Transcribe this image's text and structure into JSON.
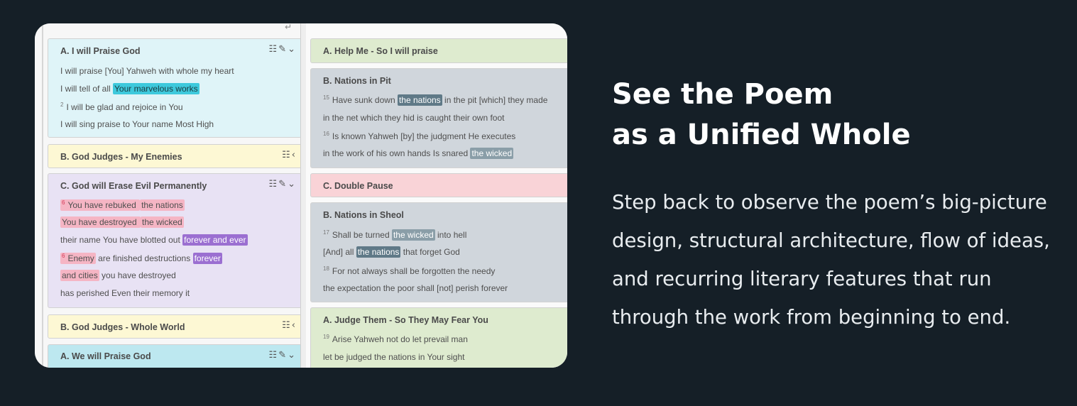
{
  "left_blocks": [
    {
      "title": "A. I will Praise God",
      "icons": "☷✎⌄",
      "lines": [
        {
          "pre": "I will praise [You] Yahweh with whole my heart"
        },
        {
          "pre": "I will tell of all ",
          "hl": "Your marvelous works"
        },
        {
          "mark": "2",
          "pre": "I will be glad  and rejoice in You"
        },
        {
          "pre": "I will sing praise to Your name Most High"
        }
      ]
    },
    {
      "title": "B. God Judges - My Enemies",
      "icons": "☷‹"
    },
    {
      "title": "C. God will Erase Evil Permanently",
      "icons": "☷✎⌄",
      "lines": [
        {
          "mark": "6",
          "pre": "You have rebuked ",
          "hl": "the nations"
        },
        {
          "pre": "You have destroyed ",
          "hl": "the wicked"
        },
        {
          "pre": "their name You have blotted out ",
          "hl": "forever and ever"
        },
        {
          "mark": "6",
          "pre": "Enemy",
          "mid": " are finished destructions ",
          "hl": "forever"
        },
        {
          "pre": "and cities",
          "mid": " you have destroyed"
        },
        {
          "pre": "has perished Even their memory it"
        }
      ]
    },
    {
      "title": "B. God Judges - Whole World",
      "icons": "☷‹"
    },
    {
      "title": "A. We will Praise God",
      "icons": "☷✎⌄"
    }
  ],
  "right_blocks": [
    {
      "title": "A. Help Me - So I will praise"
    },
    {
      "title": "B. Nations in Pit",
      "lines": [
        {
          "mark": "15",
          "pre": "Have sunk down ",
          "hl": "the nations",
          "post": " in the pit [which] they made"
        },
        {
          "pre": "in the net which they hid is caught their own foot"
        },
        {
          "mark": "16",
          "pre": "Is known  Yahweh [by] the judgment He executes"
        },
        {
          "pre": "in the work of his own hands Is snared ",
          "hl": "the wicked"
        }
      ]
    },
    {
      "title": "C. Double Pause"
    },
    {
      "title": "B. Nations in Sheol",
      "lines": [
        {
          "mark": "17",
          "pre": "Shall be turned ",
          "hl": "the wicked",
          "post": " into hell"
        },
        {
          "pre": "[And] all ",
          "hl": "the nations",
          "post": " that forget God"
        },
        {
          "mark": "18",
          "pre": "For  not always shall be forgotten the needy"
        },
        {
          "pre": "the expectation the poor shall [not] perish forever"
        }
      ]
    },
    {
      "title": "A. Judge Them - So They May Fear You",
      "lines": [
        {
          "mark": "19",
          "pre": "Arise  Yahweh not do let prevail man"
        },
        {
          "pre": "let be judged the nations in Your sight"
        }
      ]
    }
  ],
  "marketing": {
    "headline_line1": "See the Poem",
    "headline_line2": "as a Unified Whole",
    "body_lines": [
      "Step back to observe the poem’s big-picture",
      "design, structural architecture, flow of ideas,",
      "and recurring literary features that run",
      "through the work from beginning to end."
    ]
  },
  "colors": {
    "page_bg": "#151f27",
    "cyan_block": "#dff4f8",
    "yellow_block": "#fdf8d4",
    "lavender_block": "#e8e2f4",
    "green_block": "#deebcf",
    "slate_block": "#d0d6dc",
    "pink_block": "#f9d3d7"
  }
}
